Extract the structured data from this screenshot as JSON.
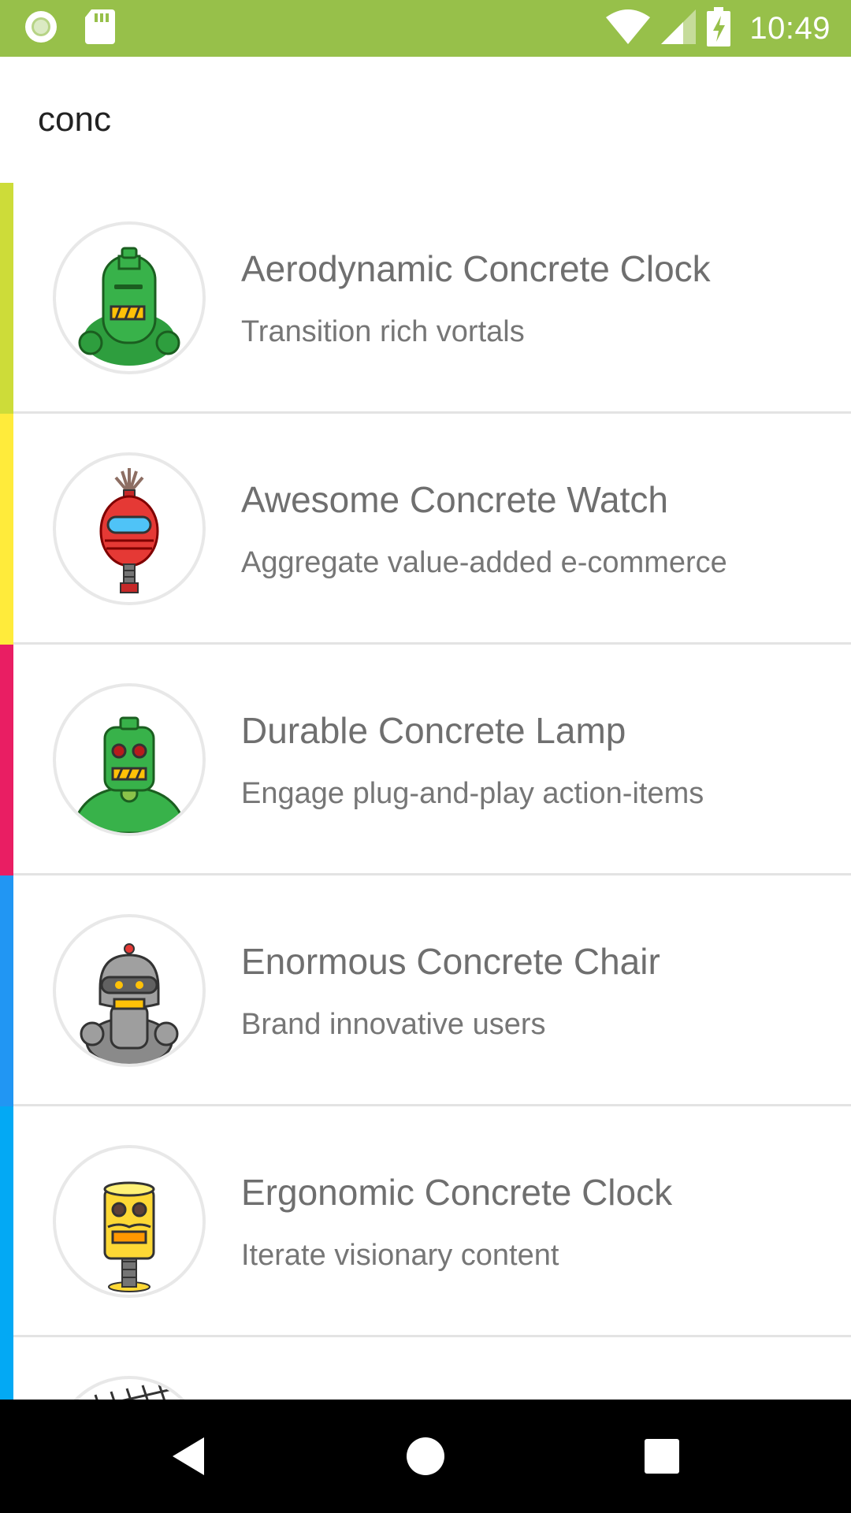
{
  "status_bar": {
    "time": "10:49",
    "icons": [
      "sync-icon",
      "sd-card-icon",
      "wifi-icon",
      "signal-icon",
      "battery-charging-icon"
    ],
    "color": "#97c04a"
  },
  "search": {
    "value": "conc"
  },
  "products": [
    {
      "name": "Aerodynamic Concrete Clock",
      "description": "Transition rich vortals",
      "accent": "#cddc39",
      "avatar": "green-robot-icon"
    },
    {
      "name": "Awesome Concrete Watch",
      "description": "Aggregate value-added e-commerce",
      "accent": "#ffeb3b",
      "avatar": "red-robot-icon"
    },
    {
      "name": "Durable Concrete Lamp",
      "description": "Engage plug-and-play action-items",
      "accent": "#e91e63",
      "avatar": "green-robot-icon"
    },
    {
      "name": "Enormous Concrete Chair",
      "description": "Brand innovative users",
      "accent": "#2196f3",
      "avatar": "gray-robot-icon"
    },
    {
      "name": "Ergonomic Concrete Clock",
      "description": "Iterate visionary content",
      "accent": "#03a9f4",
      "avatar": "yellow-robot-icon"
    },
    {
      "name": "",
      "description": "",
      "accent": "#03a9f4",
      "avatar": "antenna-robot-icon"
    }
  ],
  "nav_bar": {
    "icons": [
      "back-icon",
      "home-icon",
      "recents-icon"
    ]
  }
}
